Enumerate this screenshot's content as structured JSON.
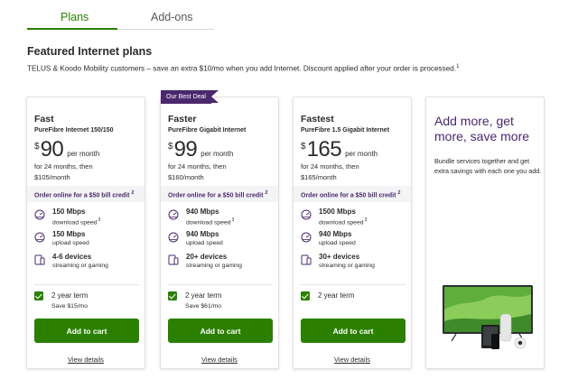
{
  "tabs": [
    {
      "label": "Plans",
      "active": true
    },
    {
      "label": "Add-ons",
      "active": false
    }
  ],
  "section_title": "Featured Internet plans",
  "promo_text": "TELUS & Koodo Mobility customers – save an extra $10/mo when you add Internet. Discount applied after your order is processed.",
  "promo_sup": "1",
  "plans": [
    {
      "ribbon": "",
      "name": "Fast",
      "product": "PureFibre Internet 150/150",
      "currency": "$",
      "price": "90",
      "per": "per month",
      "term_line1": "for 24 months, then",
      "term_line2": "$105/month",
      "credit": "Order online for a $50 bill credit",
      "credit_sup": "2",
      "features": [
        {
          "main": "150 Mbps",
          "sub": "download speed",
          "sup": "3",
          "icon": "speed-gauge-icon"
        },
        {
          "main": "150 Mbps",
          "sub": "upload speed",
          "sup": "",
          "icon": "speed-gauge-icon"
        },
        {
          "main": "4-6 devices",
          "sub": "streaming or gaming",
          "sup": "",
          "icon": "devices-icon"
        }
      ],
      "term_label": "2 year term",
      "save": "Save $15/mo",
      "cart": "Add to cart",
      "details": "View details"
    },
    {
      "ribbon": "Our Best Deal",
      "name": "Faster",
      "product": "PureFibre Gigabit Internet",
      "currency": "$",
      "price": "99",
      "per": "per month",
      "term_line1": "for 24 months, then",
      "term_line2": "$160/month",
      "credit": "Order online for a $50 bill credit",
      "credit_sup": "2",
      "features": [
        {
          "main": "940 Mbps",
          "sub": "download speed",
          "sup": "3",
          "icon": "speed-gauge-icon"
        },
        {
          "main": "940 Mbps",
          "sub": "upload speed",
          "sup": "",
          "icon": "speed-gauge-icon"
        },
        {
          "main": "20+ devices",
          "sub": "streaming or gaming",
          "sup": "",
          "icon": "devices-icon"
        }
      ],
      "term_label": "2 year term",
      "save": "Save $61/mo",
      "cart": "Add to cart",
      "details": "View details"
    },
    {
      "ribbon": "",
      "name": "Fastest",
      "product": "PureFibre 1.5 Gigabit Internet",
      "currency": "$",
      "price": "165",
      "per": "per month",
      "term_line1": "for 24 months, then",
      "term_line2": "$165/month",
      "credit": "Order online for a $50 bill credit",
      "credit_sup": "2",
      "features": [
        {
          "main": "1500 Mbps",
          "sub": "download speed",
          "sup": "3",
          "icon": "speed-gauge-icon"
        },
        {
          "main": "940 Mbps",
          "sub": "upload speed",
          "sup": "",
          "icon": "speed-gauge-icon"
        },
        {
          "main": "30+ devices",
          "sub": "streaming or gaming",
          "sup": "",
          "icon": "devices-icon"
        }
      ],
      "term_label": "2 year term",
      "save": "",
      "cart": "Add to cart",
      "details": "View details"
    }
  ],
  "addmore": {
    "title": "Add more, get more, save more",
    "body": "Bundle services together and get extra savings with each one you add."
  },
  "colors": {
    "accent_green": "#2b8000",
    "brand_purple": "#4b286d",
    "band_gray": "#f4f4f7"
  }
}
